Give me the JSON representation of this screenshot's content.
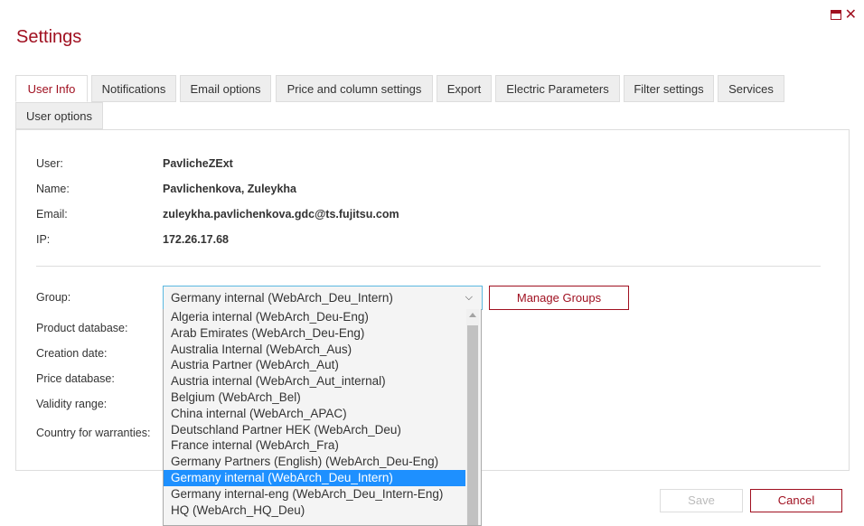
{
  "title": "Settings",
  "tabs": [
    "User Info",
    "Notifications",
    "Email options",
    "Price and column settings",
    "Export",
    "Electric Parameters",
    "Filter settings",
    "Services",
    "User options"
  ],
  "user_info": {
    "user_label": "User:",
    "user_value": "PavlicheZExt",
    "name_label": "Name:",
    "name_value": "Pavlichenkova, Zuleykha",
    "email_label": "Email:",
    "email_value": "zuleykha.pavlichenkova.gdc@ts.fujitsu.com",
    "ip_label": "IP:",
    "ip_value": "172.26.17.68"
  },
  "group": {
    "label": "Group:",
    "selected": "Germany internal (WebArch_Deu_Intern)",
    "manage_label": "Manage Groups",
    "options": [
      "Algeria internal (WebArch_Deu-Eng)",
      "Arab Emirates (WebArch_Deu-Eng)",
      "Australia Internal (WebArch_Aus)",
      "Austria Partner (WebArch_Aut)",
      "Austria internal (WebArch_Aut_internal)",
      "Belgium (WebArch_Bel)",
      "China internal (WebArch_APAC)",
      "Deutschland Partner HEK (WebArch_Deu)",
      "France internal (WebArch_Fra)",
      "Germany Partners (English) (WebArch_Deu-Eng)",
      "Germany internal (WebArch_Deu_Intern)",
      "Germany internal-eng (WebArch_Deu_Intern-Eng)",
      "HQ (WebArch_HQ_Deu)"
    ]
  },
  "labels": {
    "product_db": "Product database:",
    "creation_date": "Creation date:",
    "price_db": "Price database:",
    "validity": "Validity range:",
    "country": "Country for warranties:"
  },
  "footer": {
    "save": "Save",
    "cancel": "Cancel"
  },
  "colors": {
    "accent": "#a01020",
    "selection": "#1e90ff"
  }
}
